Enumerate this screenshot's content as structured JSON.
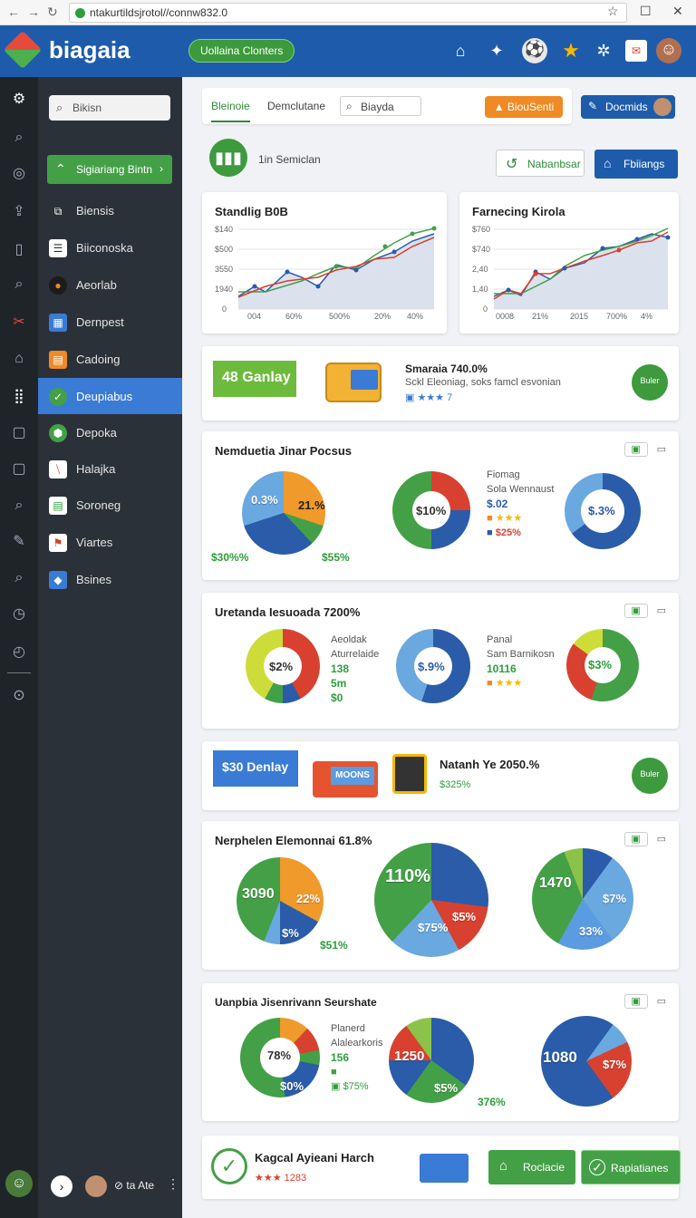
{
  "browser": {
    "url": "ntakurtildsjrotol//connw832.0"
  },
  "topbar": {
    "logo": "biagaia",
    "badge": "Uollaina Clonters"
  },
  "sidebar": {
    "search_placeholder": "Bikisn",
    "primary_button": "Sigiariang Bintn",
    "items": [
      {
        "label": "Biensis",
        "icon": "layers-icon",
        "color": "#2b3138"
      },
      {
        "label": "Biiconoska",
        "icon": "list-icon",
        "color": "#ffffff"
      },
      {
        "label": "Aeorlab",
        "icon": "orb-icon",
        "color": "#1c1c1c"
      },
      {
        "label": "Dernpest",
        "icon": "grid-icon",
        "color": "#3a7bd5"
      },
      {
        "label": "Cadoing",
        "icon": "bars-icon",
        "color": "#ef8a24"
      },
      {
        "label": "Deupiabus",
        "icon": "hex-icon",
        "color": "#43a047"
      },
      {
        "label": "Depoka",
        "icon": "hex-icon",
        "color": "#43a047"
      },
      {
        "label": "Halajka",
        "icon": "slash-icon",
        "color": "#ffffff"
      },
      {
        "label": "Soroneg",
        "icon": "table-icon",
        "color": "#ffffff"
      },
      {
        "label": "Viartes",
        "icon": "tag-icon",
        "color": "#ffffff"
      },
      {
        "label": "Bsines",
        "icon": "note-icon",
        "color": "#3a7bd5"
      }
    ],
    "footer_text": "⊘ ta Ate"
  },
  "main": {
    "tabs": [
      "Bleinoie",
      "Demclutane"
    ],
    "tab_search": "Biayda",
    "orange_button": "BiouSenti",
    "doc_button": "Docmids",
    "subtitle": "1in Semiclan",
    "btn_n": "Nabanbsar",
    "btn_f": "Fbiiangs"
  },
  "charts": {
    "c1_title": "Standlig B0B",
    "c2_title": "Farnecing Kirola",
    "c1_y": [
      "$140",
      "$500",
      "3550",
      "1940",
      "0"
    ],
    "c1_x": [
      "004",
      "60%",
      "500%",
      "20%",
      "40%"
    ],
    "c2_y": [
      "$760",
      "$740",
      "2,40",
      "1,40",
      "0"
    ],
    "c2_x": [
      "0008",
      "21%",
      "2015",
      "700%",
      "4%"
    ]
  },
  "promo1": {
    "ribbon": "48 Ganlay",
    "title": "Smaraia 740.0%",
    "sub": "Sckl Eleoniag, soks famcl esvonian",
    "badge": "Buler"
  },
  "pies1": {
    "title": "Nemduetia Jinar Pocsus",
    "a": "0.3%",
    "b": "21.%",
    "c": "$30%%",
    "d": "$55%",
    "e": "$10%",
    "leg1": "Fiomag",
    "leg2": "Sola Wennaust",
    "leg3": "$.02",
    "leg4": "$25%",
    "f": "$.3%"
  },
  "pies2": {
    "title": "Uretanda Iesuoada 7200%",
    "a": "$2%",
    "leg1": "Aeoldak",
    "leg2": "Aturrelaide",
    "leg3": "138",
    "leg4": "5m",
    "leg5": "$0",
    "b": "$.9%",
    "leg6": "Panal",
    "leg7": "Sam Barnikosn",
    "leg8": "10116",
    "c": "$3%"
  },
  "promo2": {
    "ribbon": "$30 Denlay",
    "truck": "MOONS",
    "title": "Natanh Ye 2050.%",
    "sub": "$325%",
    "badge": "Buler"
  },
  "pies3": {
    "title": "Nerphelen Elemonnai 61.8%",
    "a": "3090",
    "b": "22%",
    "c": "$%",
    "d": "$51%",
    "e": "110%",
    "f": "$5%",
    "g": "$75%",
    "h": "1470",
    "i": "$7%",
    "j": "33%"
  },
  "pies4": {
    "title": "Uanpbia Jisenrivann Seurshate",
    "a": "78%",
    "b": "$0%",
    "leg1": "Planerd",
    "leg2": "Alalearkoris",
    "leg3": "156",
    "leg4": "$75%",
    "c": "1250",
    "d": "$5%",
    "e": "376%",
    "f": "1080",
    "g": "$7%"
  },
  "footer_card": {
    "title": "Kagcal Ayieani Harch",
    "sub": "★★★ 1283",
    "btn1": "Roclacie",
    "btn2": "Rapiatianes"
  }
}
